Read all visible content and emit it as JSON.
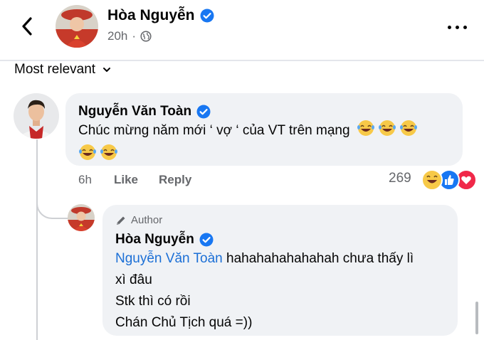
{
  "header": {
    "back_icon": "chevron-left-icon",
    "author": "Hòa Nguyễn",
    "time": "20h",
    "privacy_icon": "globe-icon",
    "more_icon": "more-horizontal-icon"
  },
  "sort": {
    "label": "Most relevant",
    "icon": "chevron-down-icon"
  },
  "comments": [
    {
      "author": "Nguyễn Văn Toàn",
      "verified": true,
      "text": "Chúc mừng năm mới ‘ vợ ‘ của VT trên mạng",
      "emoji_count": 5,
      "emoji": "😂",
      "time": "6h",
      "like_label": "Like",
      "reply_label": "Reply",
      "reaction_count": "269",
      "reactions": [
        "haha",
        "like",
        "love"
      ]
    }
  ],
  "reply": {
    "badge": "Author",
    "badge_icon": "pencil-icon",
    "author": "Hòa Nguyễn",
    "verified": true,
    "mention": "Nguyễn Văn Toàn",
    "line1_rest": " hahahahahahahah chưa thấy lì",
    "line2": "xì đâu",
    "line3": "Stk thì có rồi",
    "line4": "Chán Chủ Tịch quá =))"
  },
  "colors": {
    "verified": "#1877f2",
    "mention": "#1b6fd6",
    "bubble": "#f0f2f5",
    "secondary_text": "#65676b"
  }
}
